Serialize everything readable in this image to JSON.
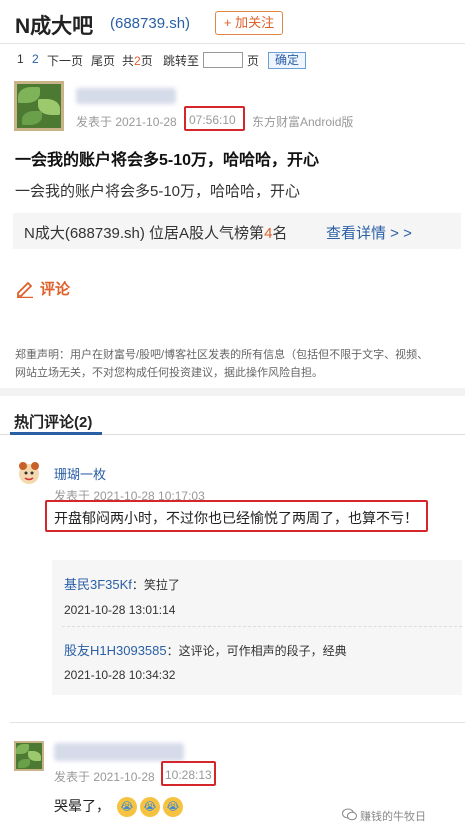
{
  "header": {
    "title": "N成大吧",
    "code": "(688739.sh)",
    "follow_label": "+ 加关注"
  },
  "pager": {
    "page1": "1",
    "page2": "2",
    "next": "下一页",
    "last": "尾页",
    "total_prefix": "共",
    "total_num": "2",
    "total_suffix": "页",
    "jump_label": "跳转至",
    "page_unit": "页",
    "confirm": "确定"
  },
  "post": {
    "meta_prefix": "发表于 2021-10-28",
    "meta_time": "07:56:10",
    "meta_source": "东方财富Android版",
    "title": "一会我的账户将会多5-10万，哈哈哈，开心",
    "body": "一会我的账户将会多5-10万，哈哈哈，开心",
    "rank_text_prefix": "N成大(688739.sh) 位居A股人气榜第",
    "rank_num": "4",
    "rank_text_suffix": "名",
    "rank_link": "查看详情 > >",
    "comment_label": "评论"
  },
  "disclaimer": {
    "line1": "郑重声明：用户在财富号/股吧/博客社区发表的所有信息（包括但不限于文字、视频、",
    "line2": "网站立场无关，不对您构成任何投资建议，据此操作风险自担。"
  },
  "hot_comments": {
    "title": "热门评论(2)",
    "items": [
      {
        "user": "珊瑚一枚",
        "meta": "发表于 2021-10-28 10:17:03",
        "text": "开盘郁闷两小时，不过你也已经愉悦了两周了，也算不亏！",
        "replies": [
          {
            "user": "基民3F35Kf",
            "text": "：笑拉了",
            "time": "2021-10-28 13:01:14"
          },
          {
            "user": "股友H1H3093585",
            "text": "：这评论，可作相声的段子，经典",
            "time": "2021-10-28 10:34:32"
          }
        ]
      },
      {
        "meta_prefix": "发表于 2021-10-28",
        "meta_time": "10:28:13",
        "text": "哭晕了，"
      }
    ]
  },
  "watermark": "赚钱的牛牧日",
  "colors": {
    "link": "#2a5fa6",
    "accent": "#e0602a",
    "highlight_box": "#d5262b"
  }
}
